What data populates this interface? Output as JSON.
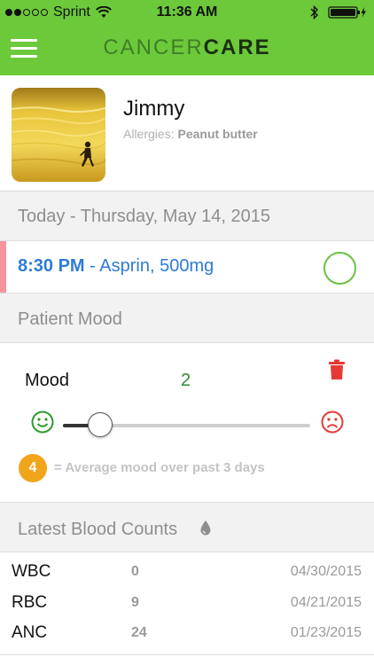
{
  "status_bar": {
    "carrier": "Sprint",
    "time": "11:36 AM",
    "signal_filled": 2,
    "signal_total": 5
  },
  "nav": {
    "brand_part1": "CANCER",
    "brand_part2": "CARE",
    "color": "#6cc93a"
  },
  "patient": {
    "name": "Jimmy",
    "allergies_label": "Allergies:",
    "allergies_value": "Peanut butter"
  },
  "today_header": "Today - Thursday, May 14, 2015",
  "medication": {
    "time": "8:30 PM",
    "separator": " - ",
    "name": "Asprin, 500mg",
    "accent_color": "#f6949c"
  },
  "mood_section": {
    "header": "Patient Mood",
    "label": "Mood",
    "value": "2",
    "slider_value": 2,
    "slider_min": 1,
    "slider_max": 10,
    "average": "4",
    "average_text": "= Average mood over past 3 days"
  },
  "blood_counts": {
    "header": "Latest Blood Counts",
    "rows": [
      {
        "name": "WBC",
        "value": "0",
        "date": "04/30/2015"
      },
      {
        "name": "RBC",
        "value": "9",
        "date": "04/21/2015"
      },
      {
        "name": "ANC",
        "value": "24",
        "date": "01/23/2015"
      }
    ]
  },
  "icons": [
    "menu-icon",
    "wifi-icon",
    "bluetooth-icon",
    "battery-icon",
    "trash-icon",
    "happy-face-icon",
    "sad-face-icon",
    "blood-drop-icon"
  ],
  "colors": {
    "accent_green": "#6cc93a",
    "med_blue": "#2f7bd6",
    "delete_red": "#e53935",
    "average_orange": "#f1a51b"
  }
}
